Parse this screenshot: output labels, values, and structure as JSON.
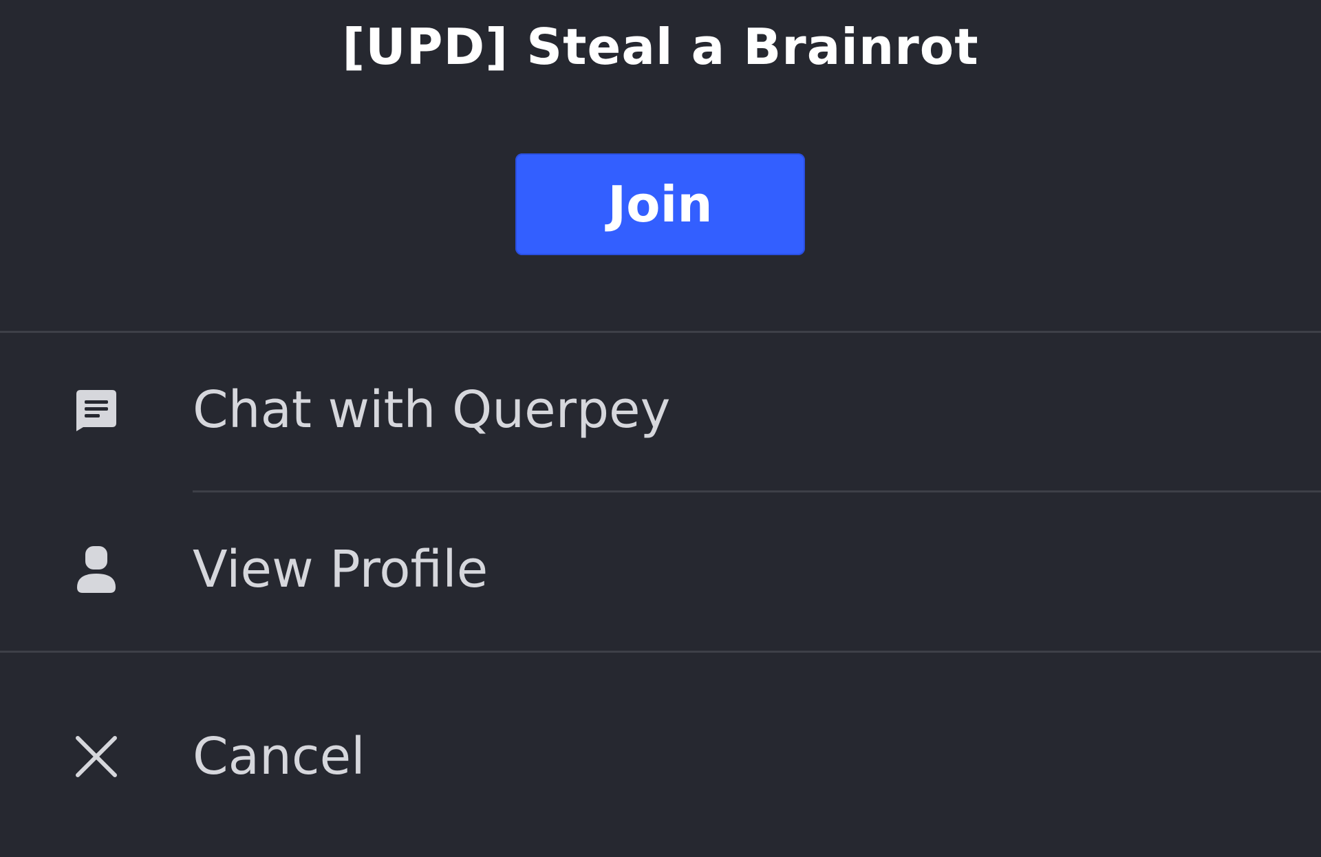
{
  "dialog": {
    "title": "[UPD] Steal a Brainrot",
    "join_label": "Join"
  },
  "menu": {
    "items": [
      {
        "label": "Chat with Querpey",
        "icon": "chat-icon"
      },
      {
        "label": "View Profile",
        "icon": "person-icon"
      },
      {
        "label": "Cancel",
        "icon": "close-icon"
      }
    ]
  },
  "colors": {
    "background": "#262830",
    "accent": "#335fff",
    "text": "#d6d7dc",
    "divider": "#3e4048"
  }
}
